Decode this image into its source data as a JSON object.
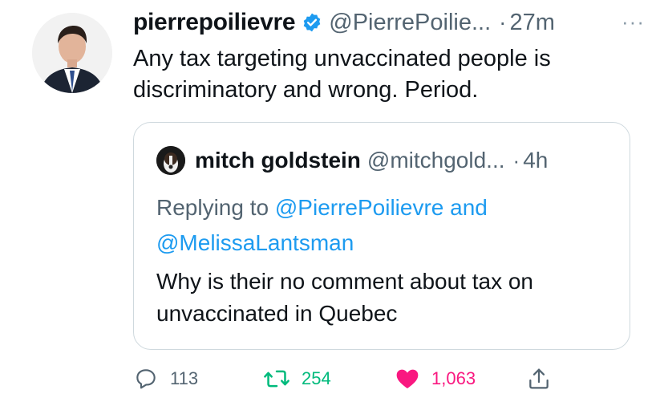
{
  "tweet": {
    "display_name": "pierrepoilievre",
    "handle": "@PierrePoilie...",
    "separator": "·",
    "time": "27m",
    "more": "···",
    "text": "Any tax targeting unvaccinated people is discriminatory and wrong. Period.",
    "verified": true
  },
  "quoted_tweet": {
    "display_name": "mitch goldstein",
    "handle": "@mitchgold...",
    "separator": "·",
    "time": "4h",
    "replying_to_prefix": "Replying to",
    "replying_to_1": "@PierrePoilievre",
    "replying_to_and": "and",
    "replying_to_2": "@MelissaLantsman",
    "text": "Why is their no comment about tax on unvaccinated in Quebec"
  },
  "actions": {
    "replies": "113",
    "retweets": "254",
    "likes": "1,063"
  },
  "colors": {
    "accent": "#1d9bf0",
    "retweet": "#00ba7c",
    "like": "#f91880",
    "secondary_text": "#536471"
  },
  "icons": [
    "verified-badge-icon",
    "reply-icon",
    "retweet-icon",
    "like-heart-icon",
    "share-icon",
    "more-options-icon"
  ]
}
